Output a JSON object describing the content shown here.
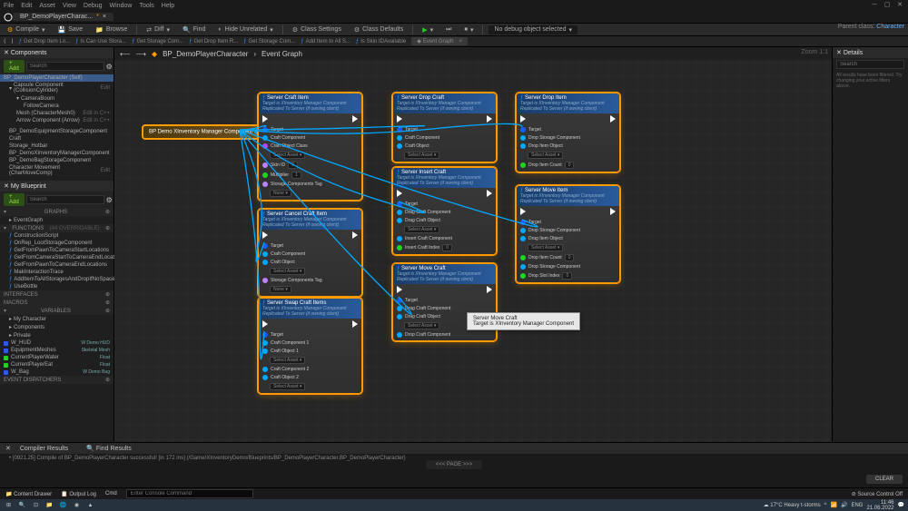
{
  "menubar": [
    "File",
    "Edit",
    "Asset",
    "View",
    "Debug",
    "Window",
    "Tools",
    "Help"
  ],
  "tab": {
    "title": "BP_DemoPlayerCharac...",
    "dirty": "*",
    "close": "×"
  },
  "toolbar": {
    "compile": "Compile",
    "save": "Save",
    "browse": "Browse",
    "diff": "Diff",
    "find": "Find",
    "hide_unrelated": "Hide Unrelated",
    "class_settings": "Class Settings",
    "class_defaults": "Class Defaults",
    "no_debug": "No debug object selected"
  },
  "parent_class": {
    "label": "Parent class:",
    "value": "Character"
  },
  "sub_toolbar": [
    "Get Drop Item Lo...",
    "Is Can Use Stora...",
    "Get Storage Com...",
    "Get Drop Item R...",
    "Get Storage Com...",
    "Add Item to All S...",
    "Is Skin IDAvailable",
    "Event Graph"
  ],
  "components": {
    "header": "Components",
    "add": "+ Add",
    "search_ph": "Search",
    "root": "BP_DemoPlayerCharacter (Self)",
    "items": [
      {
        "n": "Capsule Component (CollisionCylinder)",
        "edit": "Edit"
      },
      {
        "n": "CameraBoom"
      },
      {
        "n": "FollowCamera"
      },
      {
        "n": "Mesh (CharacterMesh0)",
        "edit": "Edit in C++"
      },
      {
        "n": "Arrow Component (Arrow)",
        "edit": "Edit in C++"
      }
    ],
    "extra": [
      "BP_DemoEquipmentStorageComponent",
      "Craft",
      "Storage_Hotbar",
      "BP_DemoXInventoryManagerComponent",
      "BP_DemoBagStorageComponent"
    ],
    "last": {
      "n": "Character Movement (CharMoveComp)",
      "edit": "Edit"
    }
  },
  "myblueprint": {
    "header": "My Blueprint",
    "add": "+ Add",
    "search_ph": "Search",
    "graphs": {
      "h": "GRAPHS",
      "item": "EventGraph"
    },
    "functions": {
      "h": "FUNCTIONS",
      "sub": "(44 OVERRIDABLE)",
      "items": [
        "ConstructionScript",
        "OnRep_LootStorageComponent",
        "GetFromPawnToCameraStartLocations",
        "GetFromCameraStartToCameraEndLocations",
        "GetFromPawnToCameraEndLocations",
        "MakInteractionTrace",
        "AddItemToAllStoragesAndDropIfNoSpace",
        "UseBottle"
      ]
    },
    "interfaces": "INTERFACES",
    "macros": "MACROS",
    "variables": {
      "h": "VARIABLES",
      "items": [
        {
          "n": "My Character"
        },
        {
          "n": "Components"
        },
        {
          "n": "Private"
        },
        {
          "n": "W_HUD",
          "t": "W Demo HUD",
          "c": "#2a5aff"
        },
        {
          "n": "EquipmentMeshes",
          "t": "Skeletal Mesh",
          "c": "#2a5aff"
        },
        {
          "n": "CurrentPlayerWater",
          "t": "Float",
          "c": "#1fd61f"
        },
        {
          "n": "CurrentPlayerEat",
          "t": "Float",
          "c": "#1fd61f"
        },
        {
          "n": "W_Bag",
          "t": "W Demo Bag",
          "c": "#2a5aff"
        }
      ]
    },
    "dispatchers": "EVENT DISPATCHERS"
  },
  "breadcrumb": {
    "bp": "BP_DemoPlayerCharacter",
    "graph": "Event Graph"
  },
  "zoom": "Zoom 1:1",
  "watermark": "BLUEPRINT",
  "comp_node": "BP Demo XInventory Manager Component",
  "nodes": {
    "sub": "Target is XInventory Manager Component",
    "sub2": "Replicated To Server (if owning client)",
    "target": "Target",
    "craft_comp": "Craft Component",
    "craft_obj_class": "Craft Object Class",
    "craft_obj": "Craft Object",
    "selass": "Select Asset",
    "drag_craft_comp": "Drag Craft Component",
    "drag_craft_obj": "Drag Craft Object",
    "drop_craft_comp": "Drop Craft Component",
    "insert_craft_comp": "Insert Craft Component",
    "insert_craft_idx": "Insert Craft Index",
    "drop_storage_comp": "Drop Storage Component",
    "drop_item_obj": "Drop Item Object",
    "drop_item_count": "Drop Item Count",
    "drag_item_obj": "Drag Item Object",
    "drop_slot_idx": "Drop Slot Index",
    "skin_id": "Skin ID",
    "multiplier": "Multiplier",
    "storage_tag": "Storage Components Tag",
    "none": "None",
    "craft_obj1": "Craft Object 1",
    "craft_comp1": "Craft Component 1",
    "craft_obj2": "Craft Object 2",
    "craft_comp2": "Craft Component 2",
    "n1": "Server Craft Item",
    "n2": "Server Drop Craft",
    "n3": "Server Drop Item",
    "n4": "Server Insert Craft",
    "n5": "Server Move Item",
    "n6": "Server Cancel Craft Item",
    "n7": "Server Move Craft",
    "n8": "Server Swap Craft Items",
    "zero": "0",
    "one": "1"
  },
  "tooltip": {
    "l1": "Server Move Craft",
    "l2": "Target is XInventory Manager Component"
  },
  "details": {
    "header": "Details",
    "search_ph": "Search",
    "msg": "All results have been filtered. Try changing your active filters above."
  },
  "compiler": {
    "header": "Compiler Results",
    "find": "Find Results",
    "log": "[0921.25] Compile of BP_DemoPlayerCharacter successful! [in 172 ms] (/Game/XInventoryDemo/Blueprints/BP_DemoPlayerCharacter.BP_DemoPlayerCharacter)",
    "clear": "CLEAR",
    "page": "PAGE"
  },
  "status": {
    "drawer": "Content Drawer",
    "output": "Output Log",
    "cmd": "Cmd",
    "cmd_ph": "Enter Console Command",
    "source": "Source Control Off"
  },
  "taskbar": {
    "weather": "17°C Heavy t-storms",
    "lang": "ENG",
    "time": "11:46",
    "date": "21.06.2022"
  }
}
